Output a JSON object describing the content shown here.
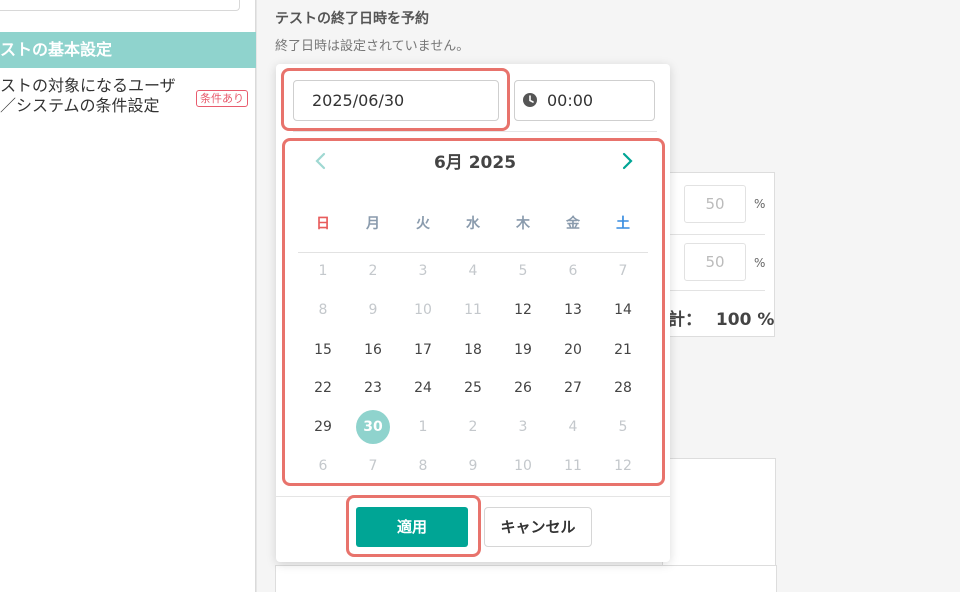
{
  "sidebar": {
    "section_title": "ストの基本設定",
    "item_label": "ストの対象になるユーザ\n／システムの条件設定",
    "badge": "条件あり"
  },
  "main": {
    "heading": "テストの終了日時を予約",
    "subheading": "終了日時は設定されていません。"
  },
  "background": {
    "field_1": "50",
    "field_2": "50",
    "percent_sign": "%",
    "total_label": "計：",
    "total_value": "100 %"
  },
  "picker": {
    "date_value": "2025/06/30",
    "time_value": "00:00",
    "month_title": "6月 2025",
    "weekdays": [
      "日",
      "月",
      "火",
      "水",
      "木",
      "金",
      "土"
    ],
    "weeks": [
      [
        "1",
        "2",
        "3",
        "4",
        "5",
        "6",
        "7"
      ],
      [
        "8",
        "9",
        "10",
        "11",
        "12",
        "13",
        "14"
      ],
      [
        "15",
        "16",
        "17",
        "18",
        "19",
        "20",
        "21"
      ],
      [
        "22",
        "23",
        "24",
        "25",
        "26",
        "27",
        "28"
      ],
      [
        "29",
        "30",
        "1",
        "2",
        "3",
        "4",
        "5"
      ],
      [
        "6",
        "7",
        "8",
        "9",
        "10",
        "11",
        "12"
      ]
    ],
    "selected_day": "30",
    "apply_label": "適用",
    "cancel_label": "キャンセル"
  },
  "colors": {
    "accent": "#00a595",
    "selected": "#8fd3cd",
    "highlight": "#e8736c",
    "sunday": "#e85c5c",
    "saturday": "#3a8ee0"
  },
  "icons": {
    "prev": "chevron-left-icon",
    "next": "chevron-right-icon",
    "time": "clock-icon"
  }
}
